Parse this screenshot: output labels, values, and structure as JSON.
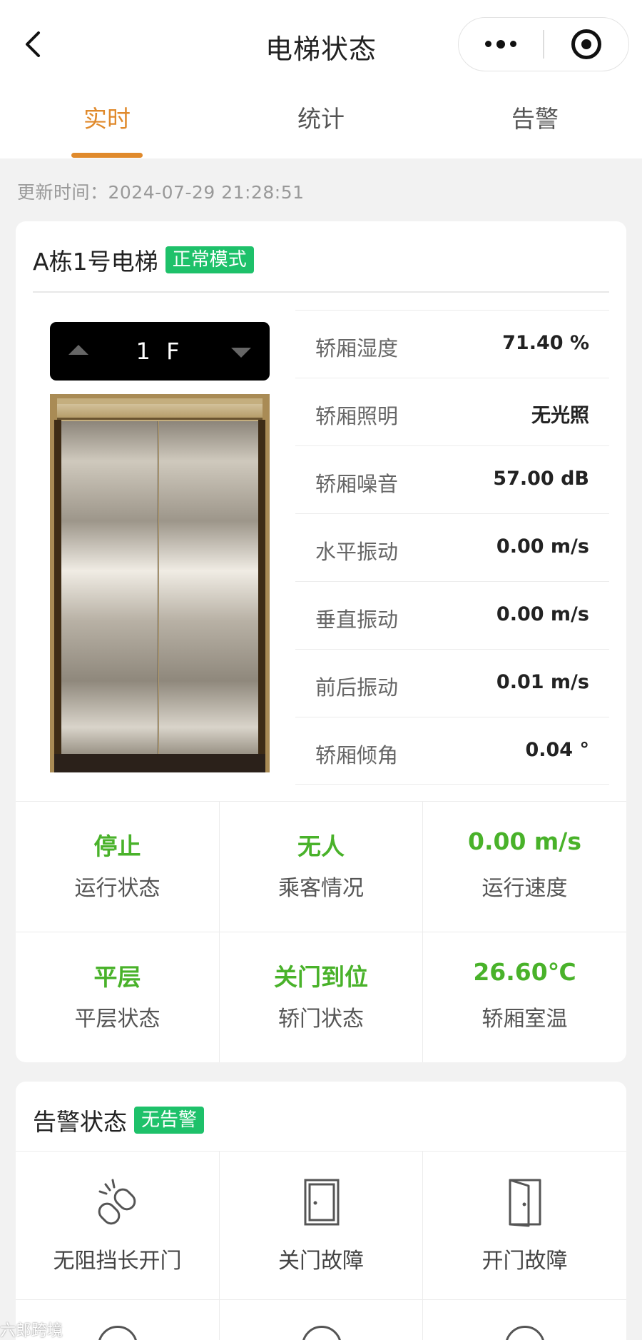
{
  "header": {
    "title": "电梯状态"
  },
  "tabs": [
    {
      "label": "实时",
      "active": true
    },
    {
      "label": "统计",
      "active": false
    },
    {
      "label": "告警",
      "active": false
    }
  ],
  "update_time": "更新时间：2024-07-29 21:28:51",
  "elevator": {
    "name": "A栋1号电梯",
    "mode_badge": "正常模式",
    "floor": "1 F",
    "metrics": [
      {
        "label": "轿厢湿度",
        "value": "71.40 %"
      },
      {
        "label": "轿厢照明",
        "value": "无光照"
      },
      {
        "label": "轿厢噪音",
        "value": "57.00 dB"
      },
      {
        "label": "水平振动",
        "value": "0.00 m/s"
      },
      {
        "label": "垂直振动",
        "value": "0.00 m/s"
      },
      {
        "label": "前后振动",
        "value": "0.01 m/s"
      },
      {
        "label": "轿厢倾角",
        "value": "0.04 °"
      }
    ],
    "status_cells": [
      {
        "value": "停止",
        "label": "运行状态"
      },
      {
        "value": "无人",
        "label": "乘客情况"
      },
      {
        "value": "0.00 m/s",
        "label": "运行速度"
      },
      {
        "value": "平层",
        "label": "平层状态"
      },
      {
        "value": "关门到位",
        "label": "轿门状态"
      },
      {
        "value": "26.60℃",
        "label": "轿厢室温"
      }
    ]
  },
  "alarm": {
    "title": "告警状态",
    "badge": "无告警",
    "items": [
      {
        "label": "无阻挡长开门",
        "icon": "broken-link-icon"
      },
      {
        "label": "关门故障",
        "icon": "closed-door-icon"
      },
      {
        "label": "开门故障",
        "icon": "open-door-icon"
      }
    ]
  },
  "watermark": "六郎跨境",
  "colors": {
    "accent": "#e08a2c",
    "ok_badge": "#1ec16a",
    "status_value": "#49b22a"
  }
}
